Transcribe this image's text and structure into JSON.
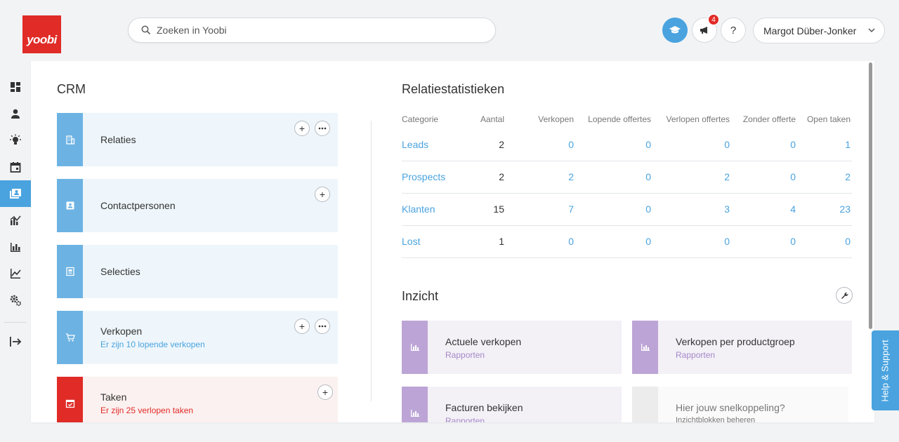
{
  "brand": {
    "logo_text": "yoobi",
    "color": "#e02b27",
    "accent": "#4aa3df"
  },
  "search": {
    "placeholder": "Zoeken in Yoobi",
    "icon": "search-icon"
  },
  "topbar": {
    "academy_icon": "graduation-cap-icon",
    "announcements_icon": "megaphone-icon",
    "announcements_badge": "4",
    "help_label": "?",
    "user_name": "Margot Düber-Jonker"
  },
  "sidebar": {
    "items": [
      {
        "icon": "dashboard-icon"
      },
      {
        "icon": "person-icon"
      },
      {
        "icon": "lightbulb-icon"
      },
      {
        "icon": "calendar-icon"
      },
      {
        "icon": "crm-contacts-icon",
        "active": true
      },
      {
        "icon": "chart-trend-icon"
      },
      {
        "icon": "bar-chart-icon"
      },
      {
        "icon": "line-chart-icon"
      },
      {
        "icon": "settings-icon"
      },
      {
        "icon": "logout-icon"
      }
    ]
  },
  "crm": {
    "title": "CRM",
    "cards": [
      {
        "title": "Relaties",
        "subtitle": "",
        "icon": "building-icon"
      },
      {
        "title": "Contactpersonen",
        "subtitle": "",
        "icon": "contact-card-icon"
      },
      {
        "title": "Selecties",
        "subtitle": "",
        "icon": "selection-icon"
      },
      {
        "title": "Verkopen",
        "subtitle": "Er zijn 10 lopende verkopen",
        "icon": "cart-icon"
      },
      {
        "title": "Taken",
        "subtitle": "Er zijn 25 verlopen taken",
        "icon": "task-calendar-icon"
      }
    ]
  },
  "stats": {
    "title": "Relatiestatistieken",
    "columns": [
      "Categorie",
      "Aantal",
      "Verkopen",
      "Lopende offertes",
      "Verlopen offertes",
      "Zonder offerte",
      "Open taken"
    ],
    "rows": [
      [
        "Leads",
        "2",
        "0",
        "0",
        "0",
        "0",
        "1"
      ],
      [
        "Prospects",
        "2",
        "2",
        "0",
        "2",
        "0",
        "2"
      ],
      [
        "Klanten",
        "15",
        "7",
        "0",
        "3",
        "4",
        "23"
      ],
      [
        "Lost",
        "1",
        "0",
        "0",
        "0",
        "0",
        "0"
      ]
    ]
  },
  "inzicht": {
    "title": "Inzicht",
    "cards": [
      {
        "title": "Actuele verkopen",
        "subtitle": "Rapporten"
      },
      {
        "title": "Verkopen per productgroep",
        "subtitle": "Rapporten"
      },
      {
        "title": "Facturen bekijken",
        "subtitle": "Rapporten"
      },
      {
        "title": "Hier jouw snelkoppeling?",
        "subtitle": "Inzichtblokken beheren"
      }
    ]
  },
  "help_tab": "Help & Support"
}
